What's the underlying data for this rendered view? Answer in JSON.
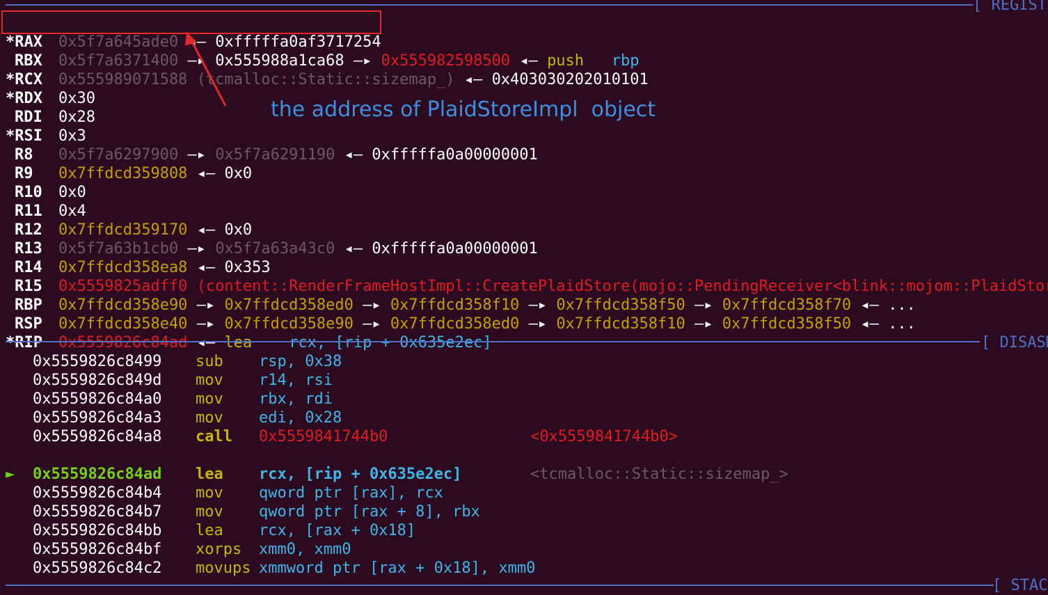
{
  "header_label": "[ REGISTERS ]",
  "disasm_label": "[ DISASM ]",
  "stack_label": "[ STACK ]",
  "annotation": "the address of PlaidStoreImpl  object",
  "registers": {
    "rax": {
      "name": "*RAX",
      "v1": "0x5f7a645ade0",
      "ar1": "◂—",
      "v2": "0xfffffa0af3717254"
    },
    "rbx": {
      "name": "RBX",
      "v1": "0x5f7a6371400",
      "ar1": "—▸",
      "v2": "0x555988a1ca68",
      "ar2": "—▸",
      "v3": "0x555982598500",
      "ar3": "◂—",
      "op": "push",
      "arg": "rbp"
    },
    "rcx": {
      "name": "*RCX",
      "v1": "0x555989071588",
      "sym": "(tcmalloc::Static::sizemap_)",
      "ar1": "◂—",
      "v2": "0x403030202010101"
    },
    "rdx": {
      "name": "*RDX",
      "v1": "0x30"
    },
    "rdi": {
      "name": "RDI",
      "v1": "0x28"
    },
    "rsi": {
      "name": "*RSI",
      "v1": "0x3"
    },
    "r8": {
      "name": "R8",
      "v1": "0x5f7a6297900",
      "ar1": "—▸",
      "v2": "0x5f7a6291190",
      "ar2": "◂—",
      "v3": "0xfffffa0a00000001"
    },
    "r9": {
      "name": "R9",
      "v1": "0x7ffdcd359808",
      "ar1": "◂—",
      "v2": "0x0"
    },
    "r10": {
      "name": "R10",
      "v1": "0x0"
    },
    "r11": {
      "name": "R11",
      "v1": "0x4"
    },
    "r12": {
      "name": "R12",
      "v1": "0x7ffdcd359170",
      "ar1": "◂—",
      "v2": "0x0"
    },
    "r13": {
      "name": "R13",
      "v1": "0x5f7a63b1cb0",
      "ar1": "—▸",
      "v2": "0x5f7a63a43c0",
      "ar2": "◂—",
      "v3": "0xfffffa0a00000001"
    },
    "r14": {
      "name": "R14",
      "v1": "0x7ffdcd358ea8",
      "ar1": "◂—",
      "v2": "0x353"
    },
    "r15": {
      "name": "R15",
      "v1": "0x5559825adff0",
      "sym": "(content::RenderFrameHostImpl::CreatePlaidStore(mojo::PendingReceiver<blink::mojom::PlaidStore"
    },
    "rbp": {
      "name": "RBP",
      "v1": "0x7ffdcd358e90",
      "v2": "0x7ffdcd358ed0",
      "v3": "0x7ffdcd358f10",
      "v4": "0x7ffdcd358f50",
      "v5": "0x7ffdcd358f70",
      "tail": "..."
    },
    "rsp": {
      "name": "RSP",
      "v1": "0x7ffdcd358e40",
      "v2": "0x7ffdcd358e90",
      "v3": "0x7ffdcd358ed0",
      "v4": "0x7ffdcd358f10",
      "v5": "0x7ffdcd358f50",
      "tail": "..."
    },
    "rip": {
      "name": "*RIP",
      "v1": "0x5559826c84ad",
      "ar1": "◂—",
      "op": "lea",
      "a1": "rcx,",
      "a2": "[rip + 0x635e2ec]"
    }
  },
  "arrows": {
    "right": "—▸",
    "left": "◂—"
  },
  "disasm": [
    {
      "addr": "0x5559826c8499",
      "op": "sub",
      "args": "rsp, 0x38"
    },
    {
      "addr": "0x5559826c849d",
      "op": "mov",
      "args": "r14, rsi"
    },
    {
      "addr": "0x5559826c84a0",
      "op": "mov",
      "args": "rbx, rdi"
    },
    {
      "addr": "0x5559826c84a3",
      "op": "mov",
      "args": "edi, 0x28"
    },
    {
      "addr": "0x5559826c84a8",
      "op": "call",
      "args": "0x5559841744b0",
      "comment": "<0x5559841744b0>"
    },
    {
      "addr": "0x5559826c84ad",
      "op": "lea",
      "args": "rcx, [rip + 0x635e2ec]",
      "comment": "<tcmalloc::Static::sizemap_>",
      "marker": "►"
    },
    {
      "addr": "0x5559826c84b4",
      "op": "mov",
      "args": "qword ptr [rax], rcx"
    },
    {
      "addr": "0x5559826c84b7",
      "op": "mov",
      "args": "qword ptr [rax + 8], rbx"
    },
    {
      "addr": "0x5559826c84bb",
      "op": "lea",
      "args": "rcx, [rax + 0x18]"
    },
    {
      "addr": "0x5559826c84bf",
      "op": "xorps",
      "args": "xmm0, xmm0"
    },
    {
      "addr": "0x5559826c84c2",
      "op": "movups",
      "args": "xmmword ptr [rax + 0x18], xmm0"
    }
  ]
}
